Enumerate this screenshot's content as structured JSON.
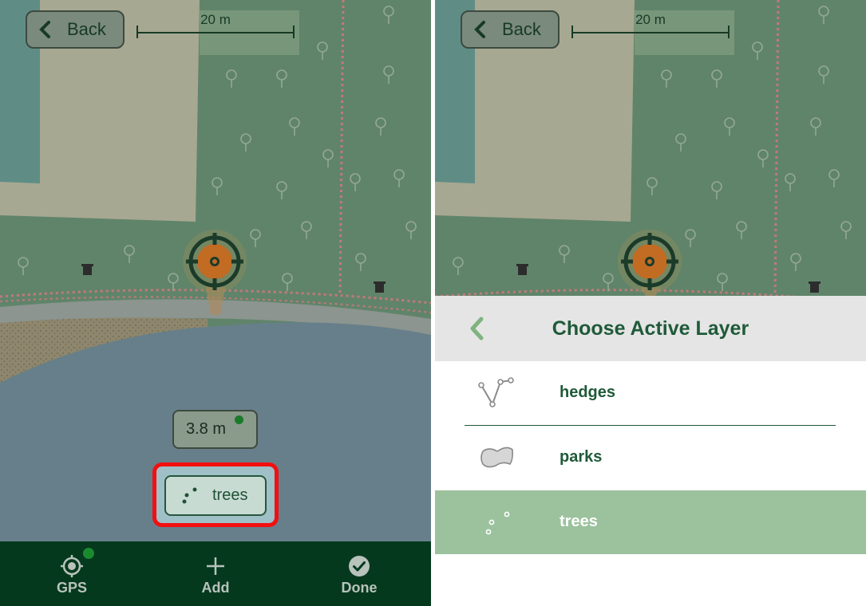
{
  "left": {
    "back_label": "Back",
    "scale_label": "20 m",
    "accuracy_label": "3.8 m",
    "active_layer_label": "trees",
    "bottom_bar": [
      {
        "label": "GPS",
        "icon": "gps-icon"
      },
      {
        "label": "Add",
        "icon": "plus-icon"
      },
      {
        "label": "Done",
        "icon": "check-circle-icon"
      }
    ]
  },
  "right": {
    "back_label": "Back",
    "scale_label": "20 m",
    "sheet_title": "Choose Active Layer",
    "layers": [
      {
        "name": "hedges",
        "icon": "line-layer-icon",
        "active": false
      },
      {
        "name": "parks",
        "icon": "polygon-layer-icon",
        "active": false
      },
      {
        "name": "trees",
        "icon": "point-layer-icon",
        "active": true
      }
    ]
  },
  "colors": {
    "brand_dark": "#05391e",
    "brand_text": "#1f5a39",
    "highlight_red": "#f30f0f",
    "active_row": "#9bc29d",
    "gps_status": "#1a8a2f"
  }
}
